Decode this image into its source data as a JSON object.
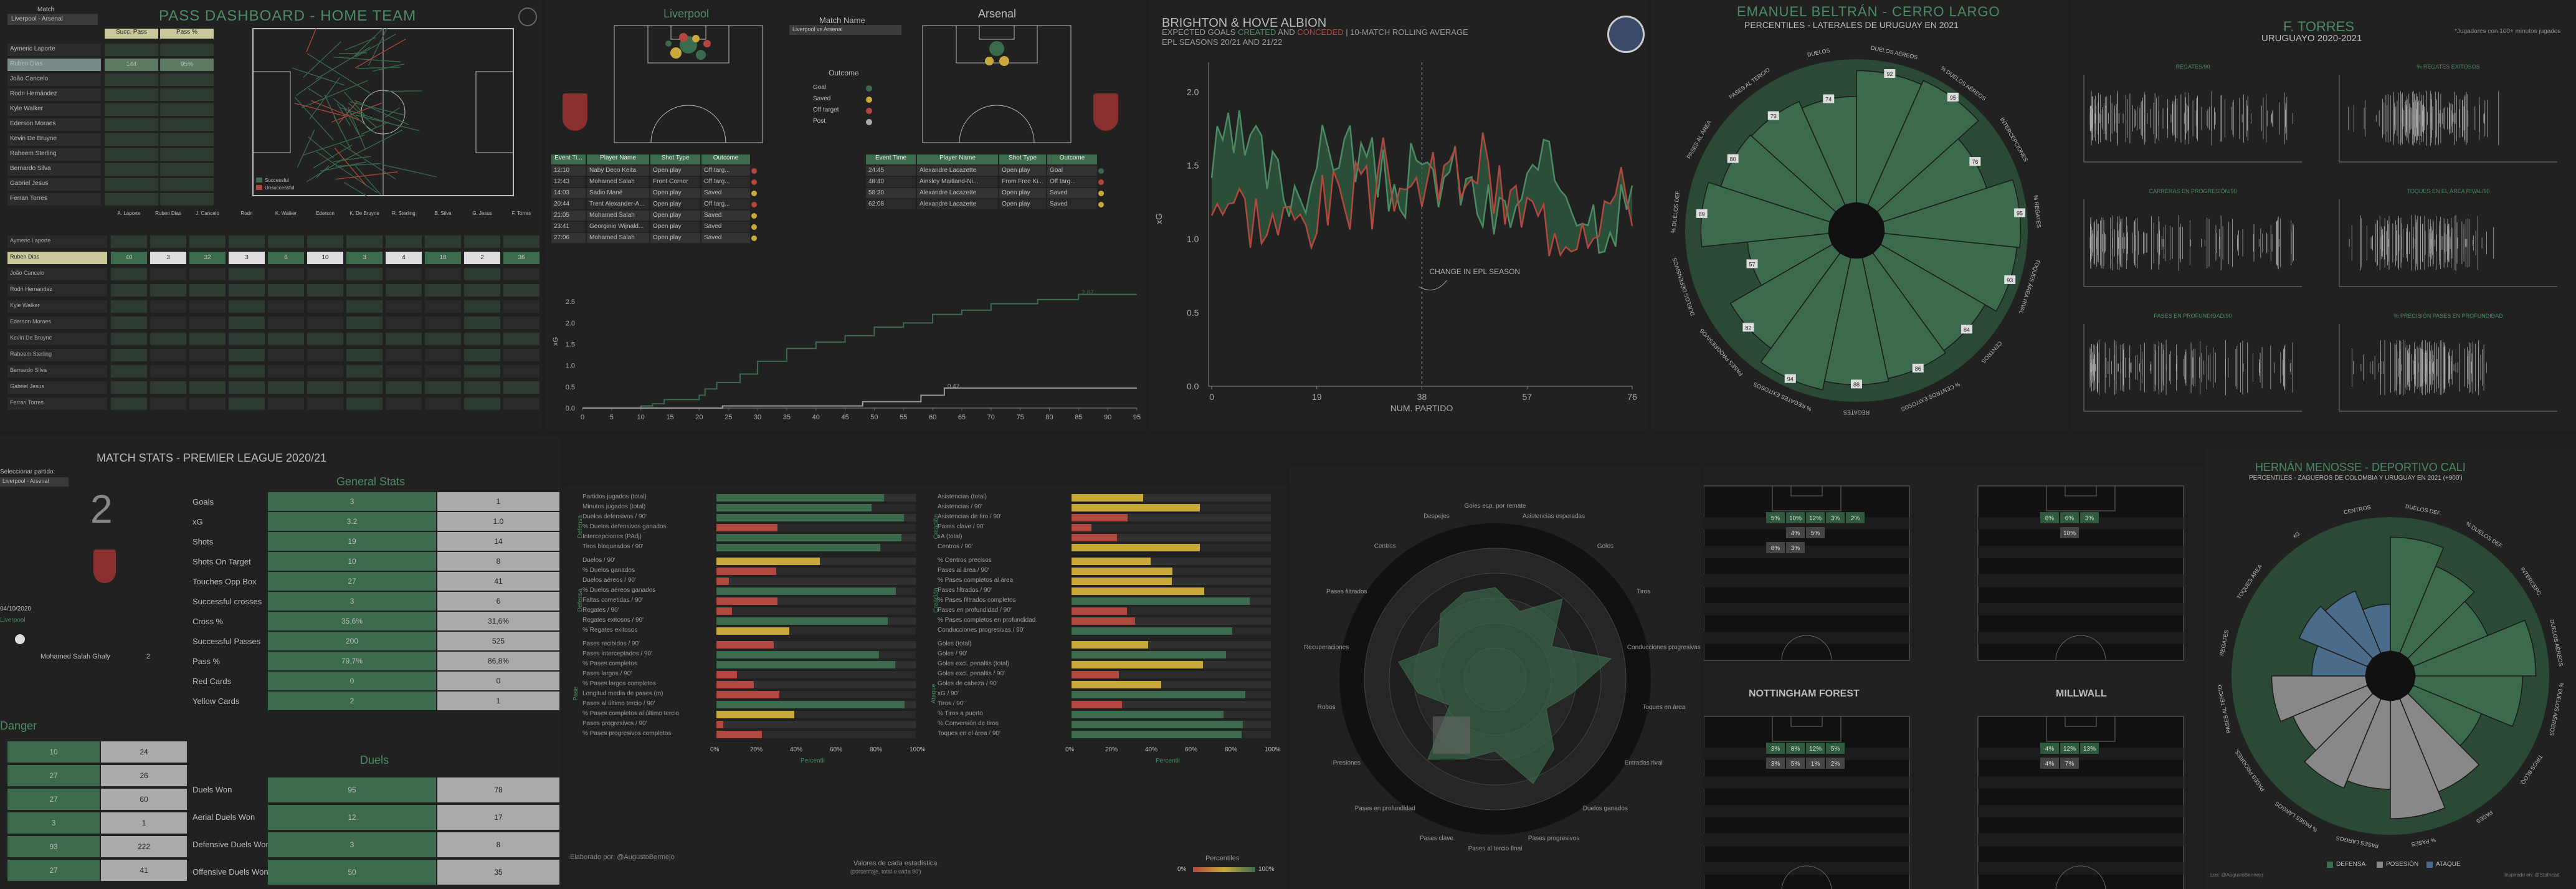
{
  "pass_dashboard": {
    "title": "PASS DASHBOARD - HOME TEAM",
    "match_label": "Match",
    "match_value": "Liverpool - Arsenal",
    "col_headers": [
      "Succ. Pass",
      "Pass %"
    ],
    "players": [
      "Aymeric Laporte",
      "Ruben Dias",
      "João Cancelo",
      "Rodri Hernández",
      "Kyle Walker",
      "Ederson Moraes",
      "Kevin De Bruyne",
      "Raheem Sterling",
      "Bernardo Silva",
      "Gabriel Jesus",
      "Ferran Torres"
    ],
    "highlight_vals": [
      "144",
      "95%"
    ],
    "legend": [
      "Successful",
      "Unsuccessful"
    ],
    "matrix_headers": [
      "A. Laporte",
      "Ruben Dias",
      "J. Cancelo",
      "Rodri",
      "K. Walker",
      "Ederson",
      "K. De Bruyne",
      "R. Sterling",
      "B. Silva",
      "G. Jesus",
      "F. Torres"
    ],
    "matrix_row": [
      "40",
      "3",
      "32",
      "3",
      "6",
      "10",
      "3",
      "4",
      "18",
      "2",
      "36"
    ]
  },
  "shot_map": {
    "home": "Liverpool",
    "away": "Arsenal",
    "match_name_label": "Match Name",
    "match_name_value": "Liverpool vs Arsenal",
    "outcome_label": "Outcome",
    "outcomes": [
      "Goal",
      "Saved",
      "Off target",
      "Post"
    ],
    "home_table_headers": [
      "Event Ti...",
      "Player Name",
      "Shot Type",
      "Outcome"
    ],
    "home_rows": [
      [
        "12:10",
        "Naby Deco Keita",
        "Open play",
        "Off targ..."
      ],
      [
        "12:43",
        "Mohamed Salah",
        "Front Corner",
        "Off targ..."
      ],
      [
        "14:03",
        "Sadio Mané",
        "Open play",
        "Saved"
      ],
      [
        "20:44",
        "Trent Alexander-A...",
        "Open play",
        "Off targ..."
      ],
      [
        "21:05",
        "Mohamed Salah",
        "Open play",
        "Saved"
      ],
      [
        "23:41",
        "Georginio Wijnald...",
        "Open play",
        "Saved"
      ],
      [
        "27:06",
        "Mohamed Salah",
        "Open play",
        "Saved"
      ]
    ],
    "away_table_headers": [
      "Event Time",
      "Player Name",
      "Shot Type",
      "Outcome"
    ],
    "away_rows": [
      [
        "24:45",
        "Alexandre Lacazette",
        "Open play",
        "Goal"
      ],
      [
        "48:40",
        "Ainsley Maitland-Ni...",
        "From Free Ki...",
        "Off targ..."
      ],
      [
        "58:30",
        "Alexandre Lacazette",
        "Open play",
        "Saved"
      ],
      [
        "62:08",
        "Alexandre Lacazette",
        "Open play",
        "Saved"
      ]
    ],
    "xg_ylabel": "xG",
    "xg_end_home": "2.67",
    "xg_end_away": "0.47",
    "xg_yticks": [
      "0.0",
      "0.5",
      "1.0",
      "1.5",
      "2.0",
      "2.5"
    ],
    "xg_xticks": [
      "0",
      "5",
      "10",
      "15",
      "20",
      "25",
      "30",
      "35",
      "40",
      "45",
      "50",
      "55",
      "60",
      "65",
      "70",
      "75",
      "80",
      "85",
      "90",
      "95"
    ]
  },
  "brighton": {
    "title": "BRIGHTON & HOVE ALBION",
    "subtitle_pre": "EXPECTED GOALS ",
    "created": "CREATED",
    "and": " AND ",
    "conceded": "CONCEDED",
    "subtitle_post": " | 10-MATCH ROLLING AVERAGE",
    "seasons": "EPL SEASONS 20/21 AND 21/22",
    "ylabel": "xG",
    "xlabel": "NUM. PARTIDO",
    "annotation": "CHANGE IN EPL SEASON",
    "yticks": [
      "0.0",
      "0.5",
      "1.0",
      "1.5",
      "2.0"
    ],
    "xticks": [
      "0",
      "19",
      "38",
      "57",
      "76"
    ]
  },
  "beltran": {
    "title": "EMANUEL BELTRÁN - CERRO LARGO",
    "subtitle": "PERCENTILES - LATERALES DE URUGUAY EN 2021",
    "labels": [
      "DUELOS AÉREOS",
      "% DUELOS AÉREOS",
      "INTERCEPCIONES",
      "% REGATES",
      "TOQUES ÁREA RIVAL",
      "CENTROS",
      "% CENTROS EXITOSOS",
      "REGATES",
      "% REGATES EXITOSOS",
      "PASES PROGRESIVOS",
      "DUELOS DEFENSIVOS",
      "% DUELOS DEF.",
      "PASES AL ÁREA",
      "PASES AL TERCIO",
      "DUELOS"
    ],
    "vals": [
      "92",
      "95",
      "76",
      "95",
      "93",
      "84",
      "86",
      "88",
      "94",
      "82",
      "57",
      "89",
      "80",
      "79",
      "74"
    ]
  },
  "torres": {
    "title": "F. TORRES",
    "subtitle": "URUGUAYO 2020-2021",
    "note": "*Jugadores con 100+ minutos jugados",
    "panels": [
      "REGATES/90",
      "% REGATES EXITOSOS",
      "CARRERAS EN PROGRESIÓN/90",
      "TOQUES EN EL ÁREA RIVAL/90",
      "PASES EN PROFUNDIDAD/90",
      "% PRECISIÓN PASES EN PROFUNDIDAD"
    ]
  },
  "match_stats": {
    "title": "MATCH STATS - PREMIER LEAGUE 2020/21",
    "select_label": "Seleccionar partido:",
    "select_value": "Liverpool - Arsenal",
    "score": "2",
    "date": "04/10/2020",
    "team": "Liverpool",
    "scorer": "Mohamed Salah Ghaly",
    "scorer_num": "2",
    "section_general": "General Stats",
    "section_duels": "Duels",
    "general": [
      [
        "Goals",
        "3",
        "1"
      ],
      [
        "xG",
        "3.2",
        "1.0"
      ],
      [
        "Shots",
        "19",
        "14"
      ],
      [
        "Shots On Target",
        "10",
        "8"
      ],
      [
        "Touches Opp Box",
        "27",
        "41"
      ],
      [
        "Successful crosses",
        "3",
        "6"
      ],
      [
        "Cross %",
        "35,6%",
        "31,6%"
      ],
      [
        "Successful Passes",
        "200",
        "525"
      ],
      [
        "Pass %",
        "79,7%",
        "86,8%"
      ],
      [
        "Red Cards",
        "0",
        "0"
      ],
      [
        "Yellow Cards",
        "2",
        "1"
      ]
    ],
    "duels": [
      [
        "Duels Won",
        "95",
        "78"
      ],
      [
        "Aerial Duels Won",
        "12",
        "17"
      ],
      [
        "Defensive Duels Won",
        "3",
        "8"
      ],
      [
        "Offensive Duels Won",
        "50",
        "35"
      ]
    ],
    "danger_label": "Danger",
    "danger": [
      [
        "10",
        "24"
      ],
      [
        "27",
        "26"
      ],
      [
        "27",
        "60"
      ],
      [
        "3",
        "1"
      ],
      [
        "93",
        "222"
      ],
      [
        "27",
        "41"
      ]
    ]
  },
  "percentile_bars": {
    "left_top": [
      "Partidos jugados (total)",
      "Minutos jugados (total)",
      "Duelos defensivos / 90'",
      "% Duelos defensivos ganados",
      "Intercepciones (PAdj)",
      "Tiros bloqueados / 90'"
    ],
    "left_mid": [
      "Duelos / 90'",
      "% Duelos ganados",
      "Duelos aéreos / 90'",
      "% Duelos aéreos ganados",
      "Faltas cometidas / 90'",
      "Regates / 90'",
      "Regates exitosos / 90'",
      "% Regates exitosos"
    ],
    "left_bot": [
      "Pases recibidos / 90'",
      "Pases interceptados / 90'",
      "% Pases completos",
      "Pases largos / 90'",
      "% Pases largos completos",
      "Longitud media de pases (m)",
      "Pases al último tercio / 90'",
      "% Pases completos al último tercio",
      "Pases progresivos / 90'",
      "% Pases progresivos completos"
    ],
    "right_top": [
      "Asistencias (total)",
      "Asistencias / 90'",
      "Asistencias de tiro / 90'",
      "Pases clave / 90'",
      "xA (total)",
      "Centros / 90'"
    ],
    "right_mid": [
      "% Centros precisos",
      "Pases al área / 90'",
      "% Pases completos al área",
      "Pases filtrados / 90'",
      "% Pases filtrados completos",
      "Pases en profundidad / 90'",
      "% Pases completos en profundidad",
      "Conducciones progresivas / 90'"
    ],
    "right_bot": [
      "Goles (total)",
      "Goles / 90'",
      "Goles excl. penaltis (total)",
      "Goles excl. penaltis / 90'",
      "Goles de cabeza / 90'",
      "xG / 90'",
      "Tiros / 90'",
      "% Tiros a puerto",
      "% Conversión de tiros",
      "Toques en el área / 90'"
    ],
    "section_labels": [
      "Defensa",
      "Creación",
      "Pase",
      "Ataque"
    ],
    "xticks": [
      "0%",
      "20%",
      "40%",
      "60%",
      "80%",
      "100%"
    ],
    "xlabel_left": "Percentil",
    "xlabel_right": "Percentil",
    "footer": "Elaborado por: @AugustoBermejo",
    "note": "Valores de cada estadística",
    "note2": "(porcentaje, total o cada 90')",
    "legend_label": "Percentiles",
    "legend_ticks": [
      "0%",
      "50%",
      "100%"
    ]
  },
  "radar": {
    "labels": [
      "Goles esp. por remate",
      "Asistencias esperadas",
      "Goles",
      "Tiros",
      "Conducciones progresivas",
      "Toques en área",
      "Entradas rival",
      "Duelos ganados",
      "Pases progresivos",
      "Pases al tercio final",
      "Pases clave",
      "Pases en profundidad",
      "Presiones",
      "Robos",
      "Recuperaciones",
      "Pases filtrados",
      "Centros",
      "Despejes"
    ]
  },
  "pitches": {
    "teams": [
      "NOTTINGHAM FOREST",
      "MILLWALL"
    ],
    "top_left": [
      [
        "5%",
        "10%",
        "12%",
        "3%",
        "2%"
      ],
      [
        "",
        "4%",
        "5%"
      ],
      [
        "8%",
        "3%",
        ""
      ]
    ],
    "top_right": [
      [
        "8%",
        "6%",
        "3%"
      ],
      [
        "",
        "18%",
        ""
      ]
    ],
    "bot_left": [
      [
        "3%",
        "8%",
        "12%",
        "5%"
      ],
      [
        "3%",
        "5%",
        "1%",
        "2%"
      ]
    ],
    "bot_right": [
      [
        "4%",
        "12%",
        "13%"
      ],
      [
        "4%",
        "7%"
      ]
    ]
  },
  "menosse": {
    "title": "HERNÁN MENOSSE - DEPORTIVO CALI",
    "subtitle": "PERCENTILES - ZAGUEROS DE COLOMBIA Y URUGUAY EN 2021 (+900')",
    "legend": [
      "DEFENSA",
      "POSESIÓN",
      "ATAQUE"
    ],
    "labels": [
      "DUELOS DEF.",
      "% DUELOS DEF.",
      "INTERCEPC.",
      "DUELOS AÉREOS",
      "% DUELOS AÉREOS",
      "TIROS BLOQ.",
      "PASES",
      "% PASES",
      "PASES LARGOS",
      "% PASES LARGOS",
      "PASES PROGRES.",
      "PASES AL TERCIO",
      "REGATES",
      "TOQUES ÁREA",
      "xG",
      "CENTROS"
    ],
    "footer": "Los: @AugustoBermejo",
    "footer2": "Inspirado en: @Stathead"
  },
  "colors": {
    "accent": "#4d8a63",
    "bg": "#1e1e1e",
    "panel": "#212121",
    "red": "#b2473e",
    "yellow": "#c9a93a"
  }
}
